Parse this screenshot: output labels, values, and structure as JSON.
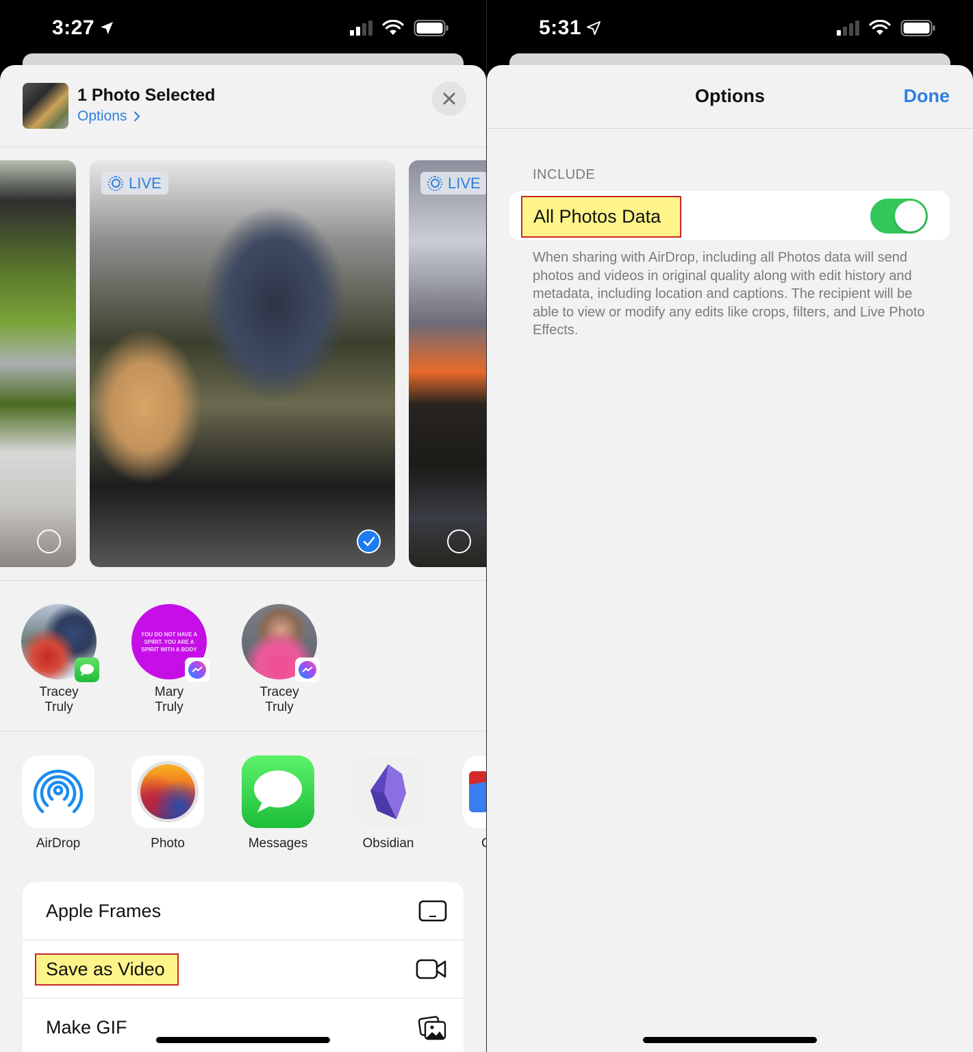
{
  "left": {
    "status": {
      "time": "3:27",
      "location_icon": "location-arrow-filled-icon",
      "signal_bars": 2,
      "signal_total": 4,
      "wifi_icon": "wifi-icon",
      "battery_icon": "battery-full-icon"
    },
    "header": {
      "title": "1 Photo Selected",
      "options_label": "Options",
      "options_chevron": "›",
      "close_icon": "close-icon"
    },
    "photos": [
      {
        "live": false,
        "live_label": "",
        "selected": false
      },
      {
        "live": true,
        "live_label": "LIVE",
        "selected": true
      },
      {
        "live": true,
        "live_label": "LIVE",
        "selected": false
      }
    ],
    "people": [
      {
        "first": "Tracey",
        "last": "Truly",
        "app_badge": "messages-icon"
      },
      {
        "first": "Mary",
        "last": "Truly",
        "app_badge": "messenger-icon",
        "avatar_text": "YOU DO NOT HAVE A SPIRIT. YOU ARE A SPIRIT WITH A BODY"
      },
      {
        "first": "Tracey",
        "last": "Truly",
        "app_badge": "messenger-icon"
      }
    ],
    "apps": [
      {
        "label": "AirDrop",
        "icon": "airdrop-icon"
      },
      {
        "label": "Photo",
        "icon": "photo-app-icon"
      },
      {
        "label": "Messages",
        "icon": "messages-icon"
      },
      {
        "label": "Obsidian",
        "icon": "obsidian-icon"
      },
      {
        "label": "C",
        "icon": "partial-app-icon"
      }
    ],
    "actions": [
      {
        "label": "Apple Frames",
        "icon": "ipad-frame-icon",
        "highlighted": false
      },
      {
        "label": "Save as Video",
        "icon": "video-camera-icon",
        "highlighted": true
      },
      {
        "label": "Make GIF",
        "icon": "photo-stack-icon",
        "highlighted": false
      }
    ]
  },
  "right": {
    "status": {
      "time": "5:31",
      "location_icon": "location-arrow-outline-icon",
      "signal_bars": 1,
      "signal_total": 4,
      "wifi_icon": "wifi-icon",
      "battery_icon": "battery-full-icon"
    },
    "header": {
      "title": "Options",
      "done_label": "Done"
    },
    "section_label": "INCLUDE",
    "option": {
      "label": "All Photos Data",
      "enabled": true,
      "highlighted": true
    },
    "footer": "When sharing with AirDrop, including all Photos data will send photos and videos in original quality along with edit history and metadata, including location and captions. The recipient will be able to view or modify any edits like crops, filters, and Live Photo Effects."
  },
  "colors": {
    "accent_blue": "#2f7fdd",
    "toggle_green": "#34c759",
    "highlight_yellow": "#fef489",
    "highlight_border": "#c8262a",
    "check_blue": "#1d7cf2"
  }
}
